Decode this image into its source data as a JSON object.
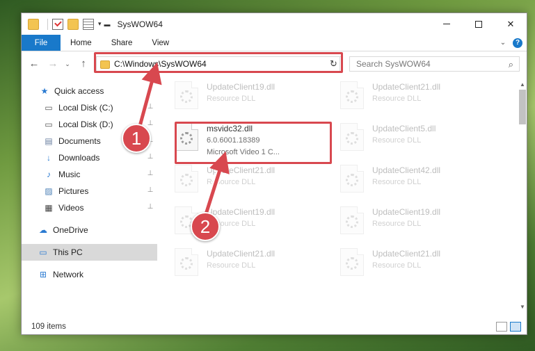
{
  "window": {
    "title": "SysWOW64"
  },
  "ribbon": {
    "tabs": [
      {
        "label": "File"
      },
      {
        "label": "Home"
      },
      {
        "label": "Share"
      },
      {
        "label": "View"
      }
    ],
    "accent_color": "#1979ca"
  },
  "address": {
    "path": "C:\\Windows\\SysWOW64"
  },
  "search": {
    "placeholder": "Search SysWOW64"
  },
  "sidebar": {
    "items": [
      {
        "label": "Quick access",
        "icon": "star-icon",
        "pinned": false
      },
      {
        "label": "Local Disk (C:)",
        "icon": "drive-icon",
        "pinned": true
      },
      {
        "label": "Local Disk (D:)",
        "icon": "drive-icon",
        "pinned": true
      },
      {
        "label": "Documents",
        "icon": "documents-icon",
        "pinned": true
      },
      {
        "label": "Downloads",
        "icon": "download-icon",
        "pinned": true
      },
      {
        "label": "Music",
        "icon": "music-icon",
        "pinned": true
      },
      {
        "label": "Pictures",
        "icon": "pictures-icon",
        "pinned": true
      },
      {
        "label": "Videos",
        "icon": "video-icon",
        "pinned": true
      },
      {
        "label": "OneDrive",
        "icon": "cloud-icon",
        "pinned": false
      },
      {
        "label": "This PC",
        "icon": "pc-icon",
        "pinned": false,
        "selected": true
      },
      {
        "label": "Network",
        "icon": "network-icon",
        "pinned": false
      }
    ]
  },
  "files": [
    {
      "name": "UpdateClient19.dll",
      "desc": "Resource DLL",
      "faded": true
    },
    {
      "name": "UpdateClient21.dll",
      "desc": "Resource DLL",
      "faded": true
    },
    {
      "name": "msvidc32.dll",
      "desc": "6.0.6001.18389",
      "desc2": "Microsoft Video 1 C...",
      "faded": false
    },
    {
      "name": "UpdateClient5.dll",
      "desc": "Resource DLL",
      "faded": true
    },
    {
      "name": "UpdateClient21.dll",
      "desc": "Resource DLL",
      "faded": true
    },
    {
      "name": "UpdateClient42.dll",
      "desc": "Resource DLL",
      "faded": true
    },
    {
      "name": "UpdateClient19.dll",
      "desc": "Resource DLL",
      "faded": true
    },
    {
      "name": "UpdateClient19.dll",
      "desc": "Resource DLL",
      "faded": true
    },
    {
      "name": "UpdateClient21.dll",
      "desc": "Resource DLL",
      "faded": true
    },
    {
      "name": "UpdateClient21.dll",
      "desc": "Resource DLL",
      "faded": true
    }
  ],
  "status": {
    "item_count": "109 items"
  },
  "callouts": [
    {
      "label": "1"
    },
    {
      "label": "2"
    }
  ],
  "highlight_color": "#d8484f"
}
